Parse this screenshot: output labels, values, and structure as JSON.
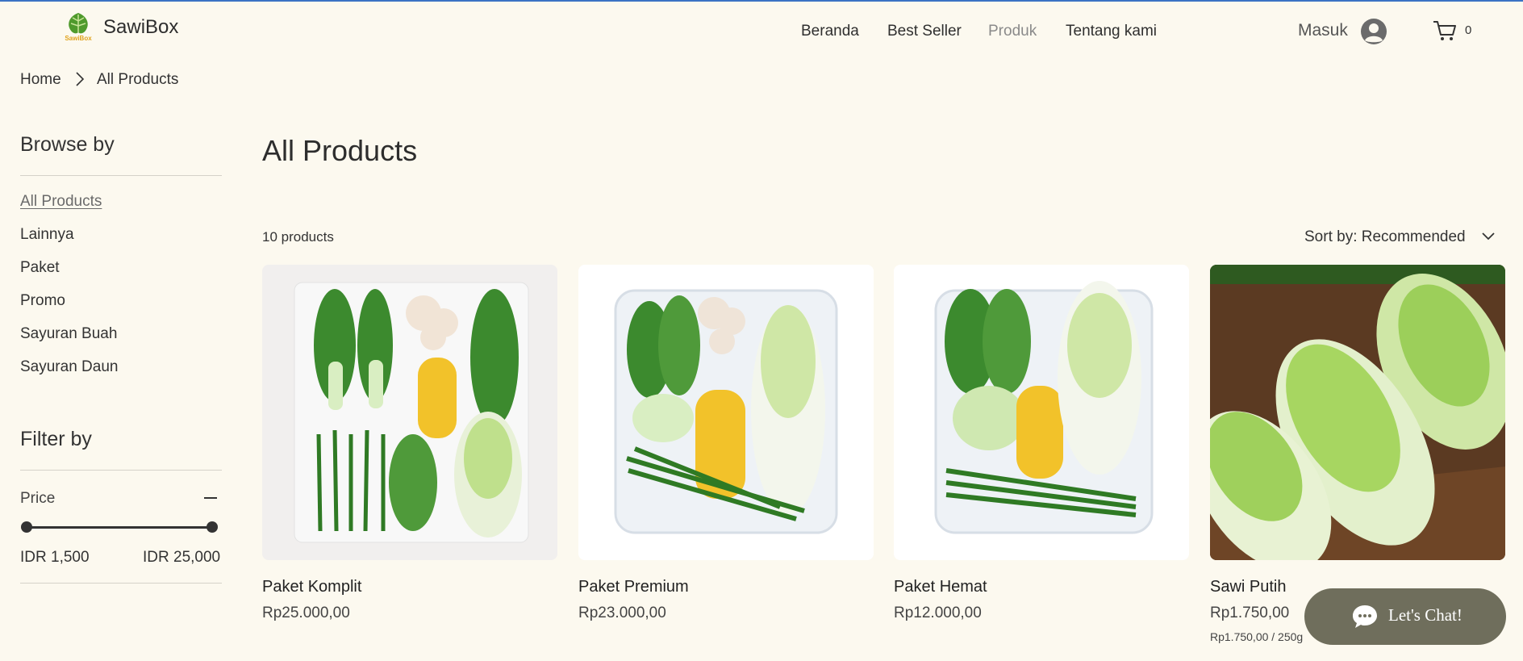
{
  "brand": {
    "name": "SawiBox",
    "logo_text": "SawiBox"
  },
  "nav": [
    {
      "label": "Beranda",
      "active": false
    },
    {
      "label": "Best Seller",
      "active": false
    },
    {
      "label": "Produk",
      "active": true
    },
    {
      "label": "Tentang kami",
      "active": false
    }
  ],
  "account": {
    "login_label": "Masuk",
    "avatar_icon": "user-avatar-icon"
  },
  "cart": {
    "icon": "cart-icon",
    "count": "0"
  },
  "breadcrumb": {
    "home": "Home",
    "current": "All Products"
  },
  "sidebar": {
    "browse_title": "Browse by",
    "categories": [
      {
        "label": "All Products",
        "active": true
      },
      {
        "label": "Lainnya",
        "active": false
      },
      {
        "label": "Paket",
        "active": false
      },
      {
        "label": "Promo",
        "active": false
      },
      {
        "label": "Sayuran Buah",
        "active": false
      },
      {
        "label": "Sayuran Daun",
        "active": false
      }
    ],
    "filter_title": "Filter by",
    "price": {
      "label": "Price",
      "min_label": "IDR 1,500",
      "max_label": "IDR 25,000"
    }
  },
  "main": {
    "title": "All Products",
    "count_label": "10 products",
    "sort_label": "Sort by: Recommended"
  },
  "products": [
    {
      "name": "Paket Komplit",
      "price": "Rp25.000,00",
      "unit": "",
      "image": "vegetable-box-complete"
    },
    {
      "name": "Paket Premium",
      "price": "Rp23.000,00",
      "unit": "",
      "image": "vegetable-box-premium"
    },
    {
      "name": "Paket Hemat",
      "price": "Rp12.000,00",
      "unit": "",
      "image": "vegetable-box-saver"
    },
    {
      "name": "Sawi Putih",
      "price": "Rp1.750,00",
      "unit": "Rp1.750,00 / 250g",
      "image": "napa-cabbage-crate"
    }
  ],
  "chat": {
    "label": "Let's Chat!",
    "icon": "chat-bubble-icon"
  },
  "colors": {
    "background": "#fcf9ef",
    "chat_button": "#6f6e5c",
    "accent_line": "#3b73c4",
    "leaf_green": "#3c8a2e",
    "corn_yellow": "#f2c22a"
  }
}
